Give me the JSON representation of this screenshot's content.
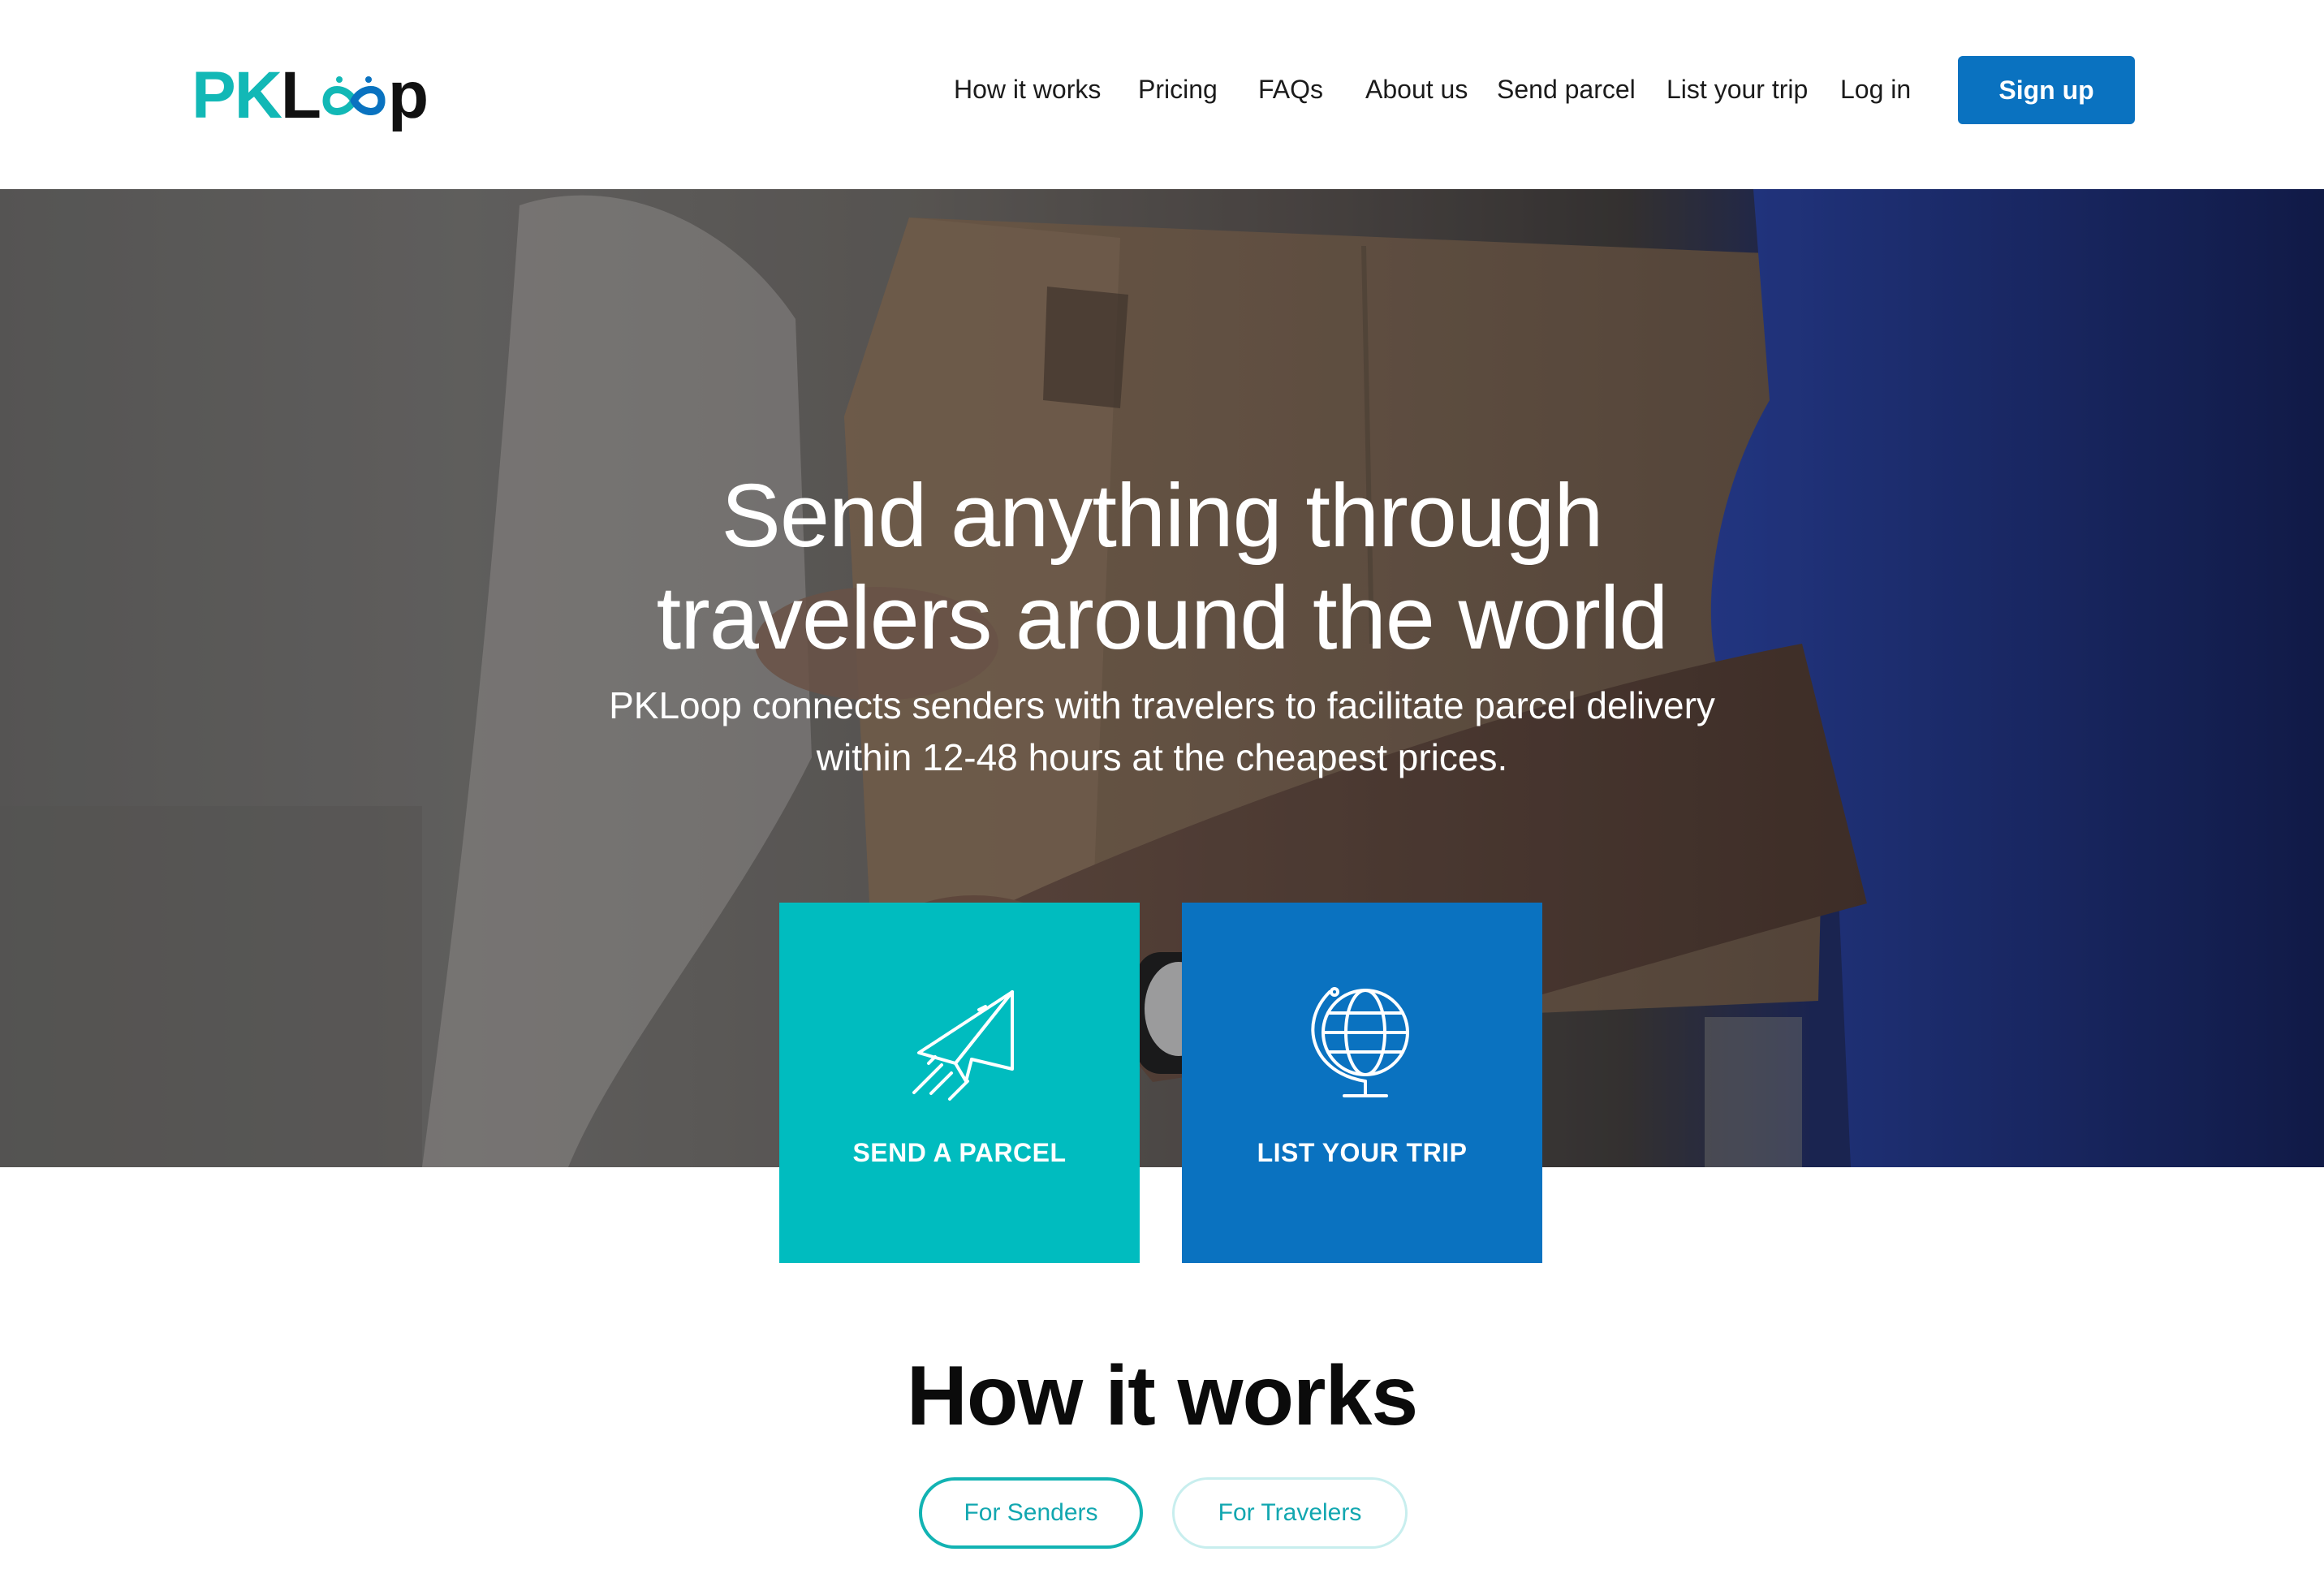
{
  "header": {
    "logo": {
      "part1": "PK",
      "part2": "L",
      "part3": "p",
      "loop_icon": "infinity-loop-icon",
      "colors": {
        "teal": "#12b8b6",
        "blue": "#0a72c0",
        "dark": "#111111"
      }
    },
    "nav": [
      {
        "label": "How it works"
      },
      {
        "label": "Pricing"
      },
      {
        "label": "FAQs"
      },
      {
        "label": "About us"
      },
      {
        "label": "Send parcel"
      },
      {
        "label": "List your trip"
      },
      {
        "label": "Log in"
      }
    ],
    "signup_label": "Sign up",
    "signup_color": "#0a72c0"
  },
  "hero": {
    "title_line1": "Send anything through",
    "title_line2": "travelers around the world",
    "subtitle_line1": "PKLoop connects senders with travelers to facilitate parcel delivery",
    "subtitle_line2": "within 12-48 hours at the cheapest prices.",
    "background": "photo of person handing a cardboard box to a courier in a blue shirt"
  },
  "actions": {
    "send": {
      "label": "SEND A PARCEL",
      "icon": "paper-plane-icon",
      "color": "#00bcbf"
    },
    "trip": {
      "label": "LIST YOUR TRIP",
      "icon": "globe-icon",
      "color": "#0a72c0"
    }
  },
  "how": {
    "title": "How it works",
    "tabs": [
      {
        "label": "For Senders",
        "active": true
      },
      {
        "label": "For Travelers",
        "active": false
      }
    ]
  }
}
